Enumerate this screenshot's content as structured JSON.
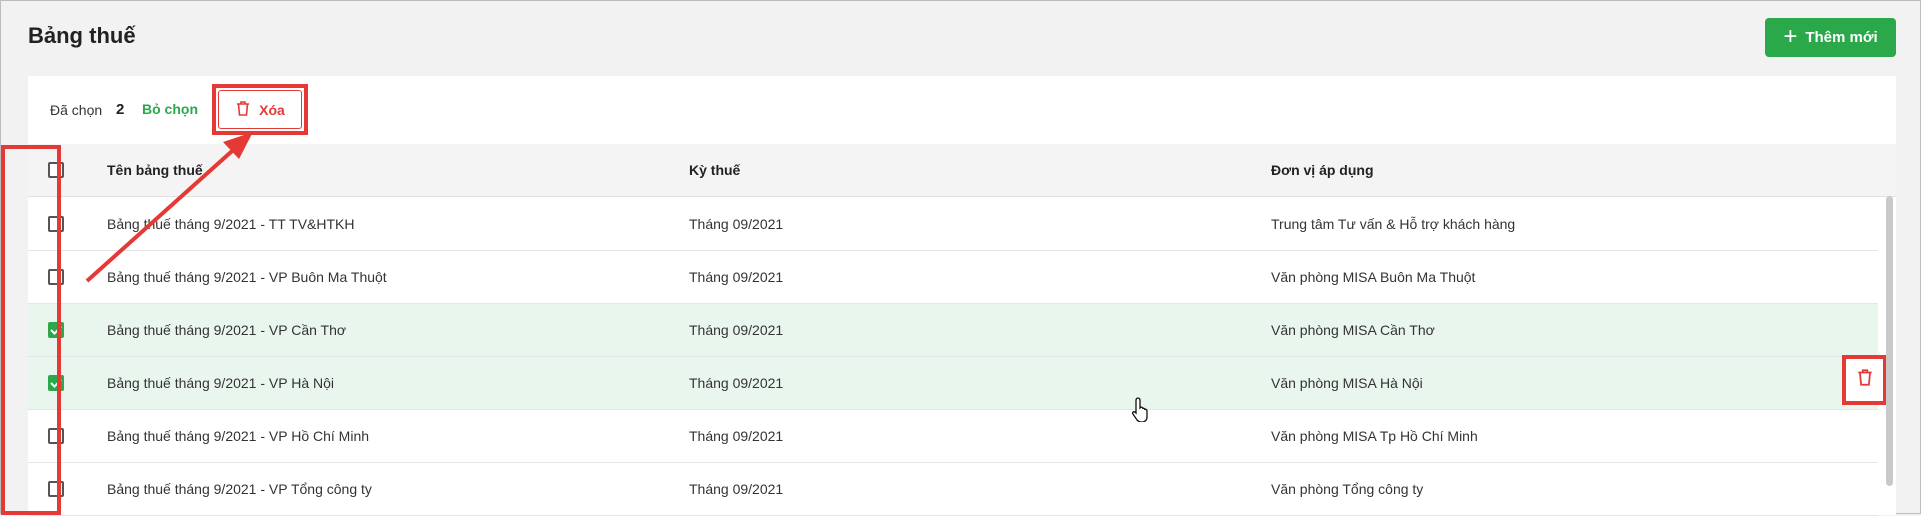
{
  "header": {
    "title": "Bảng thuế",
    "add_button": "Thêm mới"
  },
  "toolbar": {
    "selected_label": "Đã chọn",
    "selected_count": "2",
    "unselect": "Bỏ chọn",
    "delete": "Xóa"
  },
  "table": {
    "columns": [
      "Tên bảng thuế",
      "Kỳ thuế",
      "Đơn vị áp dụng"
    ],
    "rows": [
      {
        "name": "Bảng thuế tháng 9/2021 - TT TV&HTKH",
        "period": "Tháng 09/2021",
        "unit": "Trung tâm Tư vấn & Hỗ trợ khách hàng",
        "checked": false
      },
      {
        "name": "Bảng thuế tháng 9/2021 - VP Buôn Ma Thuột",
        "period": "Tháng 09/2021",
        "unit": "Văn phòng MISA Buôn Ma Thuột",
        "checked": false
      },
      {
        "name": "Bảng thuế tháng 9/2021 - VP Cần Thơ",
        "period": "Tháng 09/2021",
        "unit": "Văn phòng MISA Cần Thơ",
        "checked": true
      },
      {
        "name": "Bảng thuế tháng 9/2021 - VP Hà Nội",
        "period": "Tháng 09/2021",
        "unit": "Văn phòng MISA Hà Nội",
        "checked": true
      },
      {
        "name": "Bảng thuế tháng 9/2021 - VP Hồ Chí Minh",
        "period": "Tháng 09/2021",
        "unit": "Văn phòng MISA Tp Hồ Chí Minh",
        "checked": false
      },
      {
        "name": "Bảng thuế tháng 9/2021 - VP Tổng công ty",
        "period": "Tháng 09/2021",
        "unit": "Văn phòng Tổng công ty",
        "checked": false
      }
    ]
  },
  "icons": {
    "add": "plus-icon",
    "delete": "trash-icon",
    "cursor": "hand-pointer-icon"
  },
  "colors": {
    "accent": "#2ba84a",
    "danger": "#e53935",
    "selected_row": "#e9f6ee"
  }
}
